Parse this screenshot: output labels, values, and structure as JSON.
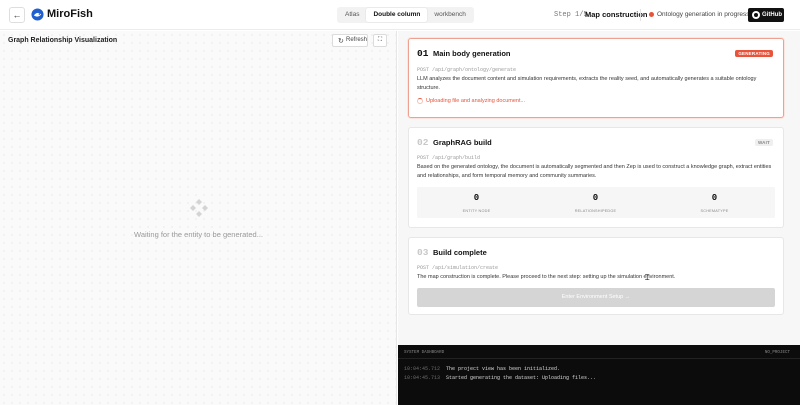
{
  "header": {
    "back_symbol": "←",
    "brand": "MiroFish",
    "views": [
      {
        "label": "Atlas",
        "active": false
      },
      {
        "label": "Double column",
        "active": true
      },
      {
        "label": "workbench",
        "active": false
      }
    ],
    "step_label": "Step 1/5",
    "step_name": "Map construction",
    "status_text": "Ontology generation in progress",
    "status_color": "#e8533a",
    "github_label": "GitHub"
  },
  "graph_panel": {
    "title": "Graph Relationship Visualization",
    "refresh_label": "Refresh",
    "expand_symbol": "⛶",
    "waiting_text": "Waiting for the entity to be generated..."
  },
  "cards": [
    {
      "num": "01",
      "title": "Main body generation",
      "badge": "GENERATING",
      "endpoint": "POST /api/graph/ontology/generate",
      "desc": "LLM analyzes the document content and simulation requirements, extracts the reality seed, and automatically generates a suitable ontology structure.",
      "progress": "Uploading file and analyzing document..."
    },
    {
      "num": "02",
      "title": "GraphRAG build",
      "badge": "WAIT",
      "endpoint": "POST /api/graph/build",
      "desc": "Based on the generated ontology, the document is automatically segmented and then Zep is used to construct a knowledge graph, extract entities and relationships, and form temporal memory and community summaries.",
      "stats": [
        {
          "value": "0",
          "label": "ENTITY NODE"
        },
        {
          "value": "0",
          "label": "RELATIONSHIPEDGE"
        },
        {
          "value": "0",
          "label": "SCHEMATYPE"
        }
      ]
    },
    {
      "num": "03",
      "title": "Build complete",
      "endpoint": "POST /api/simulation/create",
      "desc": "The map construction is complete. Please proceed to the next step: setting up the simulation environment.",
      "button_label": "Enter Environment Setup →"
    }
  ],
  "console": {
    "title": "SYSTEM DASHBOARD",
    "project": "NO_PROJECT",
    "logs": [
      {
        "time": "10:04:45.712",
        "msg": "The project view has been initialized."
      },
      {
        "time": "10:04:45.713",
        "msg": "Started generating the dataset: Uploading files..."
      }
    ]
  },
  "colors": {
    "accent": "#e8533a",
    "console_bg": "#0c0c0c"
  }
}
